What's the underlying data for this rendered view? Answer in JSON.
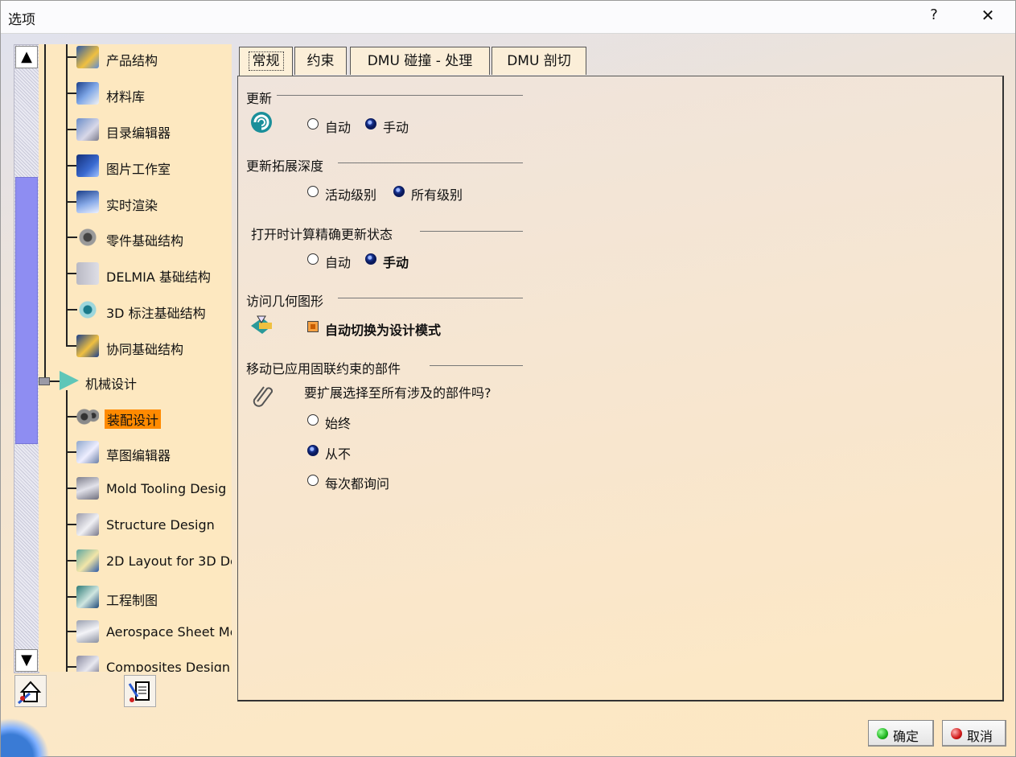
{
  "window": {
    "title": "选项",
    "help_glyph": "?",
    "close_glyph": "✕"
  },
  "scrollbar": {
    "up_glyph": "▲",
    "down_glyph": "▼"
  },
  "tree": {
    "items": [
      {
        "label": "产品结构",
        "icon": "product-structure-icon"
      },
      {
        "label": "材料库",
        "icon": "material-library-icon"
      },
      {
        "label": "目录编辑器",
        "icon": "catalog-editor-icon"
      },
      {
        "label": "图片工作室",
        "icon": "photo-studio-icon"
      },
      {
        "label": "实时渲染",
        "icon": "realtime-rendering-icon"
      },
      {
        "label": "零件基础结构",
        "icon": "part-infrastructure-icon"
      },
      {
        "label": "DELMIA 基础结构",
        "icon": "delmia-infrastructure-icon"
      },
      {
        "label": "3D 标注基础结构",
        "icon": "3d-annotation-icon"
      },
      {
        "label": "协同基础结构",
        "icon": "collaboration-icon"
      }
    ],
    "group": {
      "label": "机械设计",
      "icon": "mechanical-design-icon"
    },
    "sub_items": [
      {
        "label": "装配设计",
        "icon": "assembly-design-icon",
        "selected": true
      },
      {
        "label": "草图编辑器",
        "icon": "sketcher-icon"
      },
      {
        "label": "Mold Tooling Desig",
        "icon": "mold-tooling-icon"
      },
      {
        "label": "Structure Design",
        "icon": "structure-design-icon"
      },
      {
        "label": "2D Layout for 3D De",
        "icon": "2d-layout-icon"
      },
      {
        "label": "工程制图",
        "icon": "drafting-icon"
      },
      {
        "label": "Aerospace Sheet Me",
        "icon": "aerospace-sheet-icon"
      },
      {
        "label": "Composites Design",
        "icon": "composites-design-icon"
      }
    ]
  },
  "tabs": [
    {
      "label": "常规",
      "active": true
    },
    {
      "label": "约束",
      "active": false
    },
    {
      "label": "DMU 碰撞 - 处理",
      "active": false
    },
    {
      "label": "DMU 剖切",
      "active": false
    }
  ],
  "sections": {
    "update": {
      "title": "更新",
      "options": [
        "自动",
        "手动"
      ],
      "selected": "手动",
      "icon": "update-swirl-icon"
    },
    "update_depth": {
      "title": "更新拓展深度",
      "options": [
        "活动级别",
        "所有级别"
      ],
      "selected": "所有级别"
    },
    "open_compute": {
      "title": "打开时计算精确更新状态",
      "options": [
        "自动",
        "手动"
      ],
      "selected": "手动"
    },
    "access_geometry": {
      "title": "访问几何图形",
      "checkbox_label": "自动切换为设计模式",
      "checked": true,
      "icon": "design-mode-icon"
    },
    "move_parts": {
      "title": "移动已应用固联约束的部件",
      "question": "要扩展选择至所有涉及的部件吗?",
      "options": [
        "始终",
        "从不",
        "每次都询问"
      ],
      "selected": "从不",
      "icon": "paperclip-icon"
    }
  },
  "buttons": {
    "ok": "确定",
    "cancel": "取消"
  },
  "colors": {
    "selected_item": "#ff8a00",
    "scroll_thumb": "#8e8df2",
    "ok_led": "#1fb51f",
    "cancel_led": "#d01818"
  }
}
